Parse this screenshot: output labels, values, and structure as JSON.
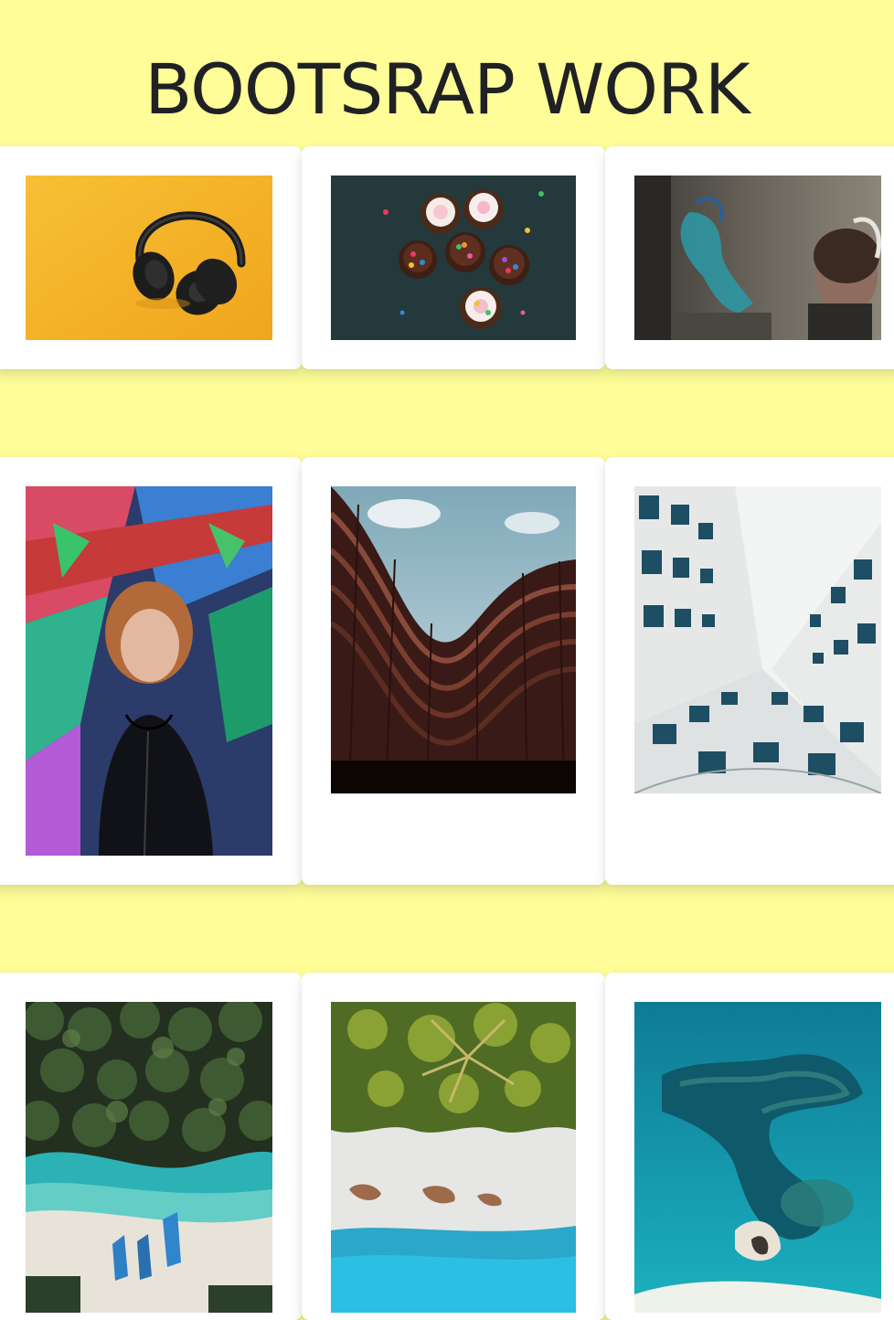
{
  "header": {
    "title": "BOOTSRAP WORK"
  },
  "colors": {
    "background": "#fefd98",
    "card": "#ffffff",
    "title": "#1f2124"
  },
  "gallery": [
    {
      "name": "headphones-photo"
    },
    {
      "name": "cupcakes-photo"
    },
    {
      "name": "street-art-woman-photo"
    },
    {
      "name": "graffiti-portrait-photo"
    },
    {
      "name": "curved-building-photo"
    },
    {
      "name": "white-tower-facade-photo"
    },
    {
      "name": "palm-beach-boats-photo"
    },
    {
      "name": "forest-shoreline-photo"
    },
    {
      "name": "aerial-reef-photo"
    }
  ]
}
